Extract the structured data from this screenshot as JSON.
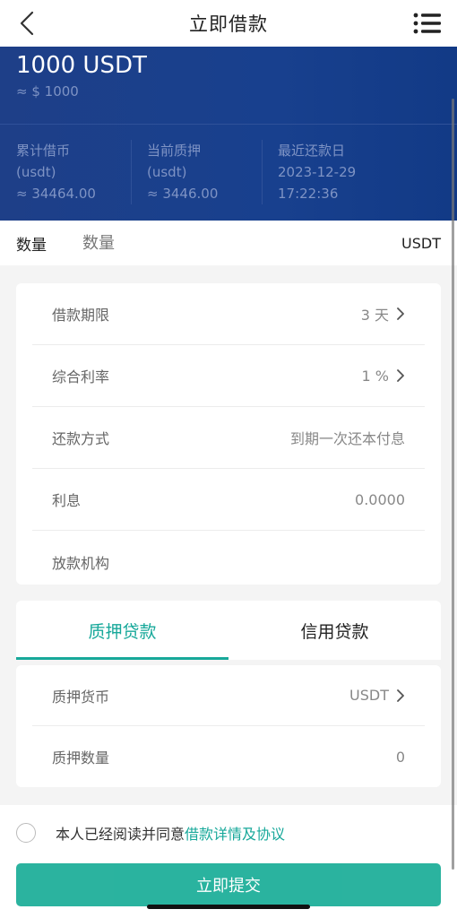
{
  "header": {
    "title": "立即借款",
    "back_icon": "chevron-left-icon",
    "menu_icon": "list-menu-icon"
  },
  "balance": {
    "amount": "1000 USDT",
    "approx": "≈ $ 1000",
    "stats": [
      {
        "label": "累计借币",
        "unit": "(usdt)",
        "value": "≈ 34464.00"
      },
      {
        "label": "当前质押",
        "unit": "(usdt)",
        "value": "≈ 3446.00"
      },
      {
        "label": "最近还款日",
        "unit": "2023-12-29",
        "value": "17:22:36"
      }
    ]
  },
  "quantity": {
    "label": "数量",
    "placeholder": "数量",
    "unit": "USDT"
  },
  "loan_details": {
    "term": {
      "label": "借款期限",
      "value": "3 天"
    },
    "rate": {
      "label": "综合利率",
      "value": "1 %"
    },
    "repayment": {
      "label": "还款方式",
      "value": "到期一次还本付息"
    },
    "interest": {
      "label": "利息",
      "value": "0.0000"
    },
    "lender": {
      "label": "放款机构",
      "value": ""
    }
  },
  "tabs": [
    {
      "label": "质押贷款",
      "active": true
    },
    {
      "label": "信用贷款",
      "active": false
    }
  ],
  "collateral": {
    "currency": {
      "label": "质押货币",
      "value": "USDT"
    },
    "amount": {
      "label": "质押数量",
      "value": "0"
    }
  },
  "agreement": {
    "text": "本人已经阅读并同意",
    "link": "借款详情及协议"
  },
  "submit_label": "立即提交",
  "colors": {
    "accent": "#17a89a",
    "hero_bg": "#1a3f8b"
  }
}
